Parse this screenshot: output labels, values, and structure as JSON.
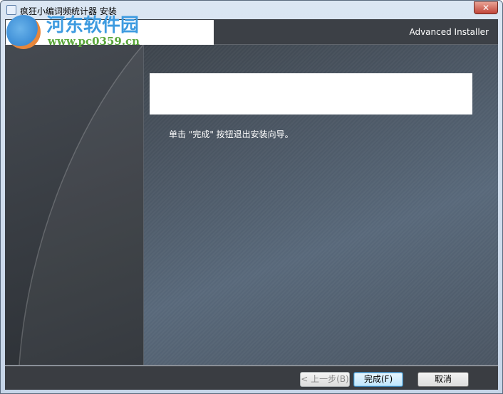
{
  "window": {
    "title": "疯狂小编词频统计器 安装",
    "close_label": "✕"
  },
  "header": {
    "brand": "Advanced Installer"
  },
  "main": {
    "message": "单击 \"完成\" 按钮退出安装向导。"
  },
  "footer": {
    "back_label": "< 上一步(B)",
    "finish_label": "完成(F)",
    "cancel_label": "取消"
  },
  "watermark": {
    "name": "河东软件园",
    "url": "www.pc0359.cn"
  }
}
